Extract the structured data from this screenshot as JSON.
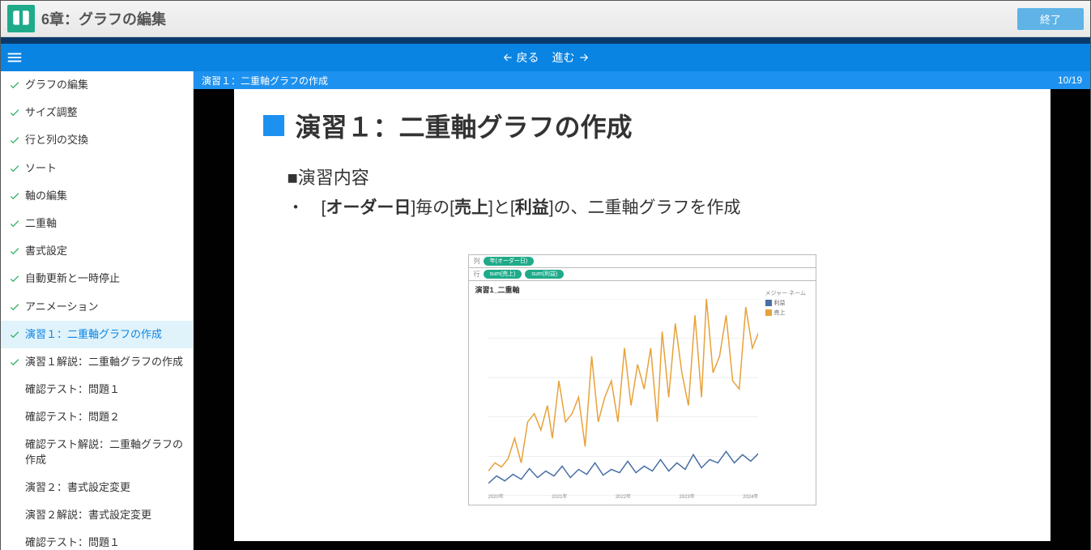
{
  "header": {
    "title": "6章：グラフの編集",
    "finish": "終了"
  },
  "nav": {
    "back": "戻る",
    "forward": "進む"
  },
  "sidebar": {
    "items": [
      {
        "label": "グラフの編集",
        "done": true
      },
      {
        "label": "サイズ調整",
        "done": true
      },
      {
        "label": "行と列の交換",
        "done": true
      },
      {
        "label": "ソート",
        "done": true
      },
      {
        "label": "軸の編集",
        "done": true
      },
      {
        "label": "二重軸",
        "done": true
      },
      {
        "label": "書式設定",
        "done": true
      },
      {
        "label": "自動更新と一時停止",
        "done": true
      },
      {
        "label": "アニメーション",
        "done": true
      },
      {
        "label": "演習１：二重軸グラフの作成",
        "done": true,
        "active": true
      },
      {
        "label": "演習１解説：二重軸グラフの作成",
        "done": true
      },
      {
        "label": "確認テスト：問題１",
        "done": false
      },
      {
        "label": "確認テスト：問題２",
        "done": false
      },
      {
        "label": "確認テスト解説：二重軸グラフの作成",
        "done": false
      },
      {
        "label": "演習２：書式設定変更",
        "done": false
      },
      {
        "label": "演習２解説：書式設定変更",
        "done": false
      },
      {
        "label": "確認テスト：問題１",
        "done": false
      }
    ]
  },
  "crumb": {
    "title": "演習１：二重軸グラフの作成",
    "page": "10/19"
  },
  "slide": {
    "title": "演習１：二重軸グラフの作成",
    "sub": "■演習内容",
    "bullet": "・　[<b>オーダー日</b>]毎の[<b>売上</b>]と[<b>利益</b>]の、二重軸グラフを作成"
  },
  "chart": {
    "pill1": "年(オーダー日)",
    "pill2": "sum(売上)",
    "pill3": "sum(利益)",
    "title": "演習1_二重軸",
    "legend_title": "メジャー ネーム",
    "l1": "利益",
    "l2": "売上",
    "xticks": [
      "2020年",
      "2021年",
      "2022年",
      "2023年",
      "2024年"
    ]
  }
}
